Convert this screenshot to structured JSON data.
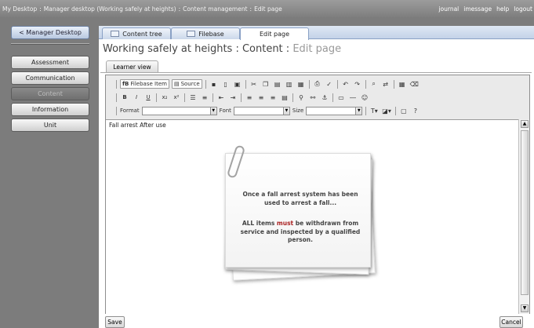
{
  "topbar": {
    "breadcrumbs": [
      "My Desktop",
      "Manager desktop (Working safely at heights)",
      "Content management",
      "Edit page"
    ],
    "links": [
      "journal",
      "imessage",
      "help",
      "logout"
    ]
  },
  "nav": {
    "back": "< Manager Desktop",
    "items": [
      "Assessment",
      "Communication",
      "Content",
      "Information",
      "Unit"
    ]
  },
  "tabs": [
    "Content tree",
    "Filebase",
    "Edit page"
  ],
  "page_title": {
    "main": "Working safely at heights : Content : ",
    "sub": "Edit page"
  },
  "learner_view": "Learner view",
  "toolbar": {
    "filebase_item": "Filebase Item",
    "source": "Source",
    "format_label": "Format",
    "font_label": "Font",
    "size_label": "Size"
  },
  "content": {
    "heading": "Fall arrest",
    "heading_rest": " After use",
    "note_line1": "Once a fall arrest system has been used to arrest a fall...",
    "note_line2_pre": "ALL items ",
    "note_line2_must": "must",
    "note_line2_post": " be withdrawn from service and inspected by a qualified person."
  },
  "buttons": {
    "save": "Save",
    "cancel": "Cancel"
  },
  "colors": {
    "accent": "#8aa1c5",
    "must": "#a22222"
  }
}
